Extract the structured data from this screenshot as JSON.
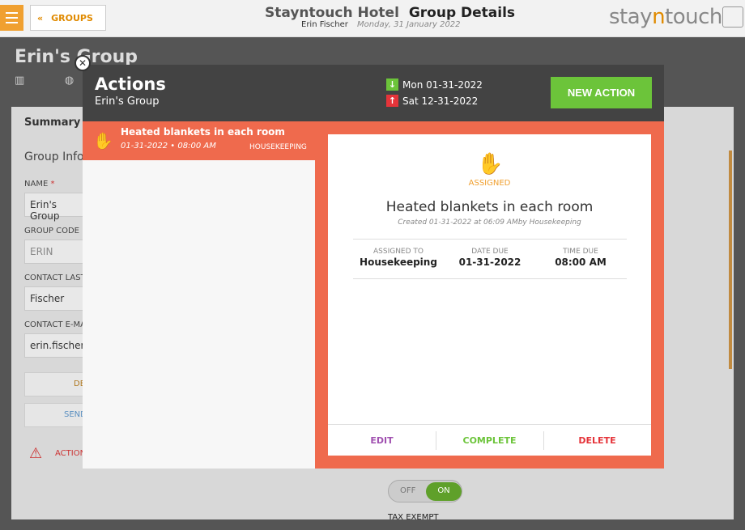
{
  "header": {
    "groups_label": "GROUPS",
    "hotel_name": "Stayntouch Hotel",
    "page_title": "Group Details",
    "user_name": "Erin Fischer",
    "business_date": "Monday, 31 January 2022",
    "brand_left": "stay",
    "brand_mid": "n",
    "brand_right": "touch"
  },
  "background": {
    "group_name": "Erin's Group",
    "summary_tab": "Summary",
    "group_info": "Group Info",
    "name_label": "NAME",
    "name_value": "Erin's Group",
    "code_label": "GROUP CODE",
    "code_value": "ERIN",
    "contact_last_label": "CONTACT LAST",
    "contact_last_value": "Fischer",
    "contact_email_label": "CONTACT E-MAI",
    "contact_email_value": "erin.fischer@",
    "btn1": "DE",
    "btn2": "SEND",
    "actions_label": "ACTION",
    "toggle_off": "OFF",
    "toggle_on": "ON",
    "tax_exempt": "TAX EXEMPT"
  },
  "modal": {
    "title": "Actions",
    "subtitle": "Erin's Group",
    "arrival_date": "Mon 01-31-2022",
    "departure_date": "Sat 12-31-2022",
    "new_action_label": "NEW ACTION",
    "colors": {
      "arrival": "#6cc43a",
      "departure": "#e5343a",
      "accent": "#ef6a4d"
    }
  },
  "action_list": [
    {
      "title": "Heated blankets in each room",
      "datetime": "01-31-2022 • 08:00 AM",
      "department": "HOUSEKEEPING",
      "icon": "hand-icon"
    }
  ],
  "detail": {
    "status": "ASSIGNED",
    "title": "Heated blankets in each room",
    "created": "Created 01-31-2022 at 06:09 AMby Housekeeping",
    "assigned_to_label": "ASSIGNED TO",
    "assigned_to_value": "Housekeeping",
    "date_due_label": "DATE DUE",
    "date_due_value": "01-31-2022",
    "time_due_label": "TIME DUE",
    "time_due_value": "08:00 AM",
    "edit_label": "EDIT",
    "complete_label": "COMPLETE",
    "delete_label": "DELETE"
  }
}
